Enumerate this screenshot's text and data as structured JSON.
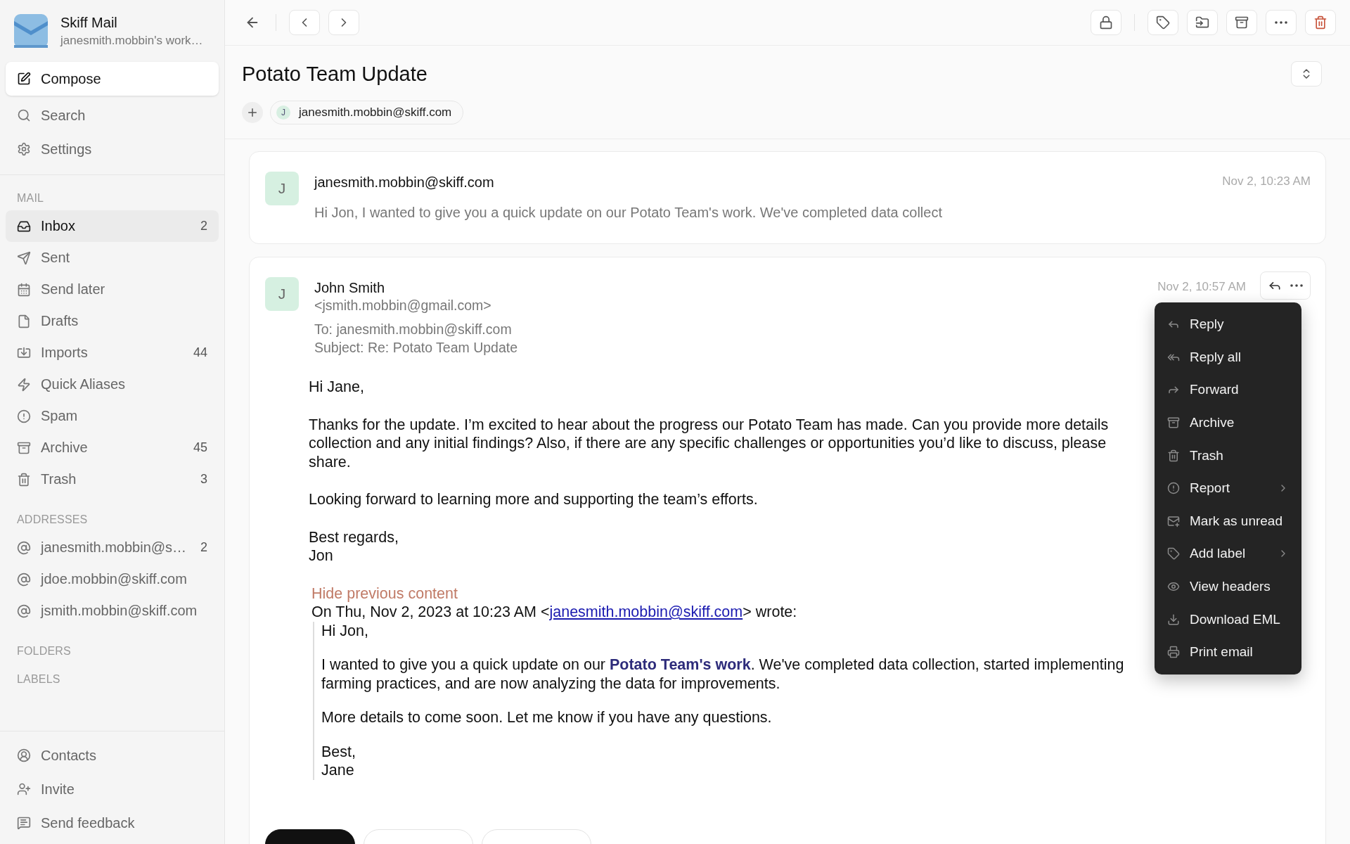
{
  "app": {
    "name": "Skiff Mail",
    "workspace": "janesmith.mobbin's work…"
  },
  "compose": "Compose",
  "top_links": [
    {
      "label": "Search"
    },
    {
      "label": "Settings"
    }
  ],
  "mail_heading": "MAIL",
  "mailboxes": [
    {
      "label": "Inbox",
      "count": "2",
      "selected": true
    },
    {
      "label": "Sent",
      "selected": false
    },
    {
      "label": "Send later",
      "selected": false
    },
    {
      "label": "Drafts",
      "selected": false
    },
    {
      "label": "Imports",
      "count": "44",
      "selected": false
    },
    {
      "label": "Quick Aliases",
      "selected": false
    },
    {
      "label": "Spam",
      "selected": false
    },
    {
      "label": "Archive",
      "count": "45",
      "selected": false
    },
    {
      "label": "Trash",
      "count": "3",
      "selected": false
    }
  ],
  "addresses_heading": "ADDRESSES",
  "addresses": [
    {
      "label": "janesmith.mobbin@s…",
      "count": "2",
      "selected": false
    },
    {
      "label": "jdoe.mobbin@skiff.com",
      "selected": false
    },
    {
      "label": "jsmith.mobbin@skiff.com",
      "selected": false
    }
  ],
  "folders_heading": "FOLDERS",
  "labels_heading": "LABELS",
  "footer_links": [
    {
      "label": "Contacts"
    },
    {
      "label": "Invite"
    },
    {
      "label": "Send feedback"
    }
  ],
  "thread": {
    "title": "Potato Team Update",
    "participant": {
      "initial": "J",
      "email": "janesmith.mobbin@skiff.com"
    }
  },
  "collapsed_message": {
    "initial": "J",
    "sender": "janesmith.mobbin@skiff.com",
    "preview": "Hi Jon, I wanted to give you a quick update on our Potato Team's work. We've completed data collect",
    "date": "Nov 2, 10:23 AM"
  },
  "open_message": {
    "initial": "J",
    "sender": "John Smith",
    "email": "<jsmith.mobbin@gmail.com>",
    "to": "To: janesmith.mobbin@skiff.com",
    "subject": "Subject: Re: Potato Team Update",
    "date": "Nov 2, 10:57 AM",
    "body": [
      [
        "Hi Jane,"
      ],
      [
        "Thanks for the update. I’m excited to hear about the progress our Potato Team has made. Can you provide more details",
        "collection and any initial findings? Also, if there are any specific challenges or opportunities you’d like to discuss, please",
        "share."
      ],
      [
        "Looking forward to learning more and supporting the team’s efforts."
      ],
      [
        "Best regards,",
        "Jon"
      ]
    ],
    "hide_link": "Hide previous content",
    "quote_header": {
      "before": "On Thu, Nov 2, 2023 at 10:23 AM <",
      "link": "janesmith.mobbin@skiff.com",
      "after": "> wrote:"
    },
    "quote": [
      [
        "Hi Jon,"
      ],
      [
        "I wanted to give you a quick update on our **Potato Team's work**. We've completed data collection, started implementing",
        "farming practices, and are now analyzing the data for improvements."
      ],
      [
        "More details to come soon. Let me know if you have any questions."
      ],
      [
        "Best,",
        "Jane"
      ]
    ],
    "actions": [
      {
        "primary": true
      },
      {
        "primary": false
      },
      {
        "primary": false
      }
    ]
  },
  "menu": [
    {
      "label": "Reply",
      "submenu": false
    },
    {
      "label": "Reply all",
      "submenu": false
    },
    {
      "label": "Forward",
      "submenu": false
    },
    {
      "label": "Archive",
      "submenu": false
    },
    {
      "label": "Trash",
      "submenu": false
    },
    {
      "label": "Report",
      "submenu": true
    },
    {
      "label": "Mark as unread",
      "submenu": false
    },
    {
      "label": "Add label",
      "submenu": true
    },
    {
      "label": "View headers",
      "submenu": false
    },
    {
      "label": "Download EML",
      "submenu": false
    },
    {
      "label": "Print email",
      "submenu": false
    }
  ]
}
